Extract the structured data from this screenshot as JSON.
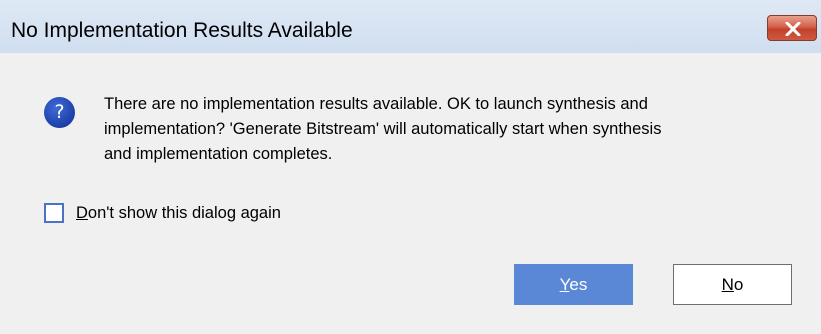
{
  "dialog": {
    "title": "No Implementation Results Available",
    "close_icon": "close-x-icon",
    "question_icon": "question-icon",
    "question_glyph": "?",
    "message_lines": [
      "There are no implementation results available. OK to launch synthesis and",
      "implementation? 'Generate Bitstream' will automatically start when synthesis",
      "and implementation completes."
    ],
    "checkbox": {
      "checked": false,
      "label_mnemonic": "D",
      "label_rest": "on't show this dialog again"
    },
    "buttons": {
      "yes_mnemonic": "Y",
      "yes_rest": "es",
      "no_mnemonic": "N",
      "no_rest": "o"
    },
    "colors": {
      "titlebar": "#cfdef0",
      "close_button": "#c2422c",
      "primary_button": "#5a87d6",
      "checkbox_border": "#4a73c8",
      "question_icon": "#1d3fa8"
    }
  }
}
